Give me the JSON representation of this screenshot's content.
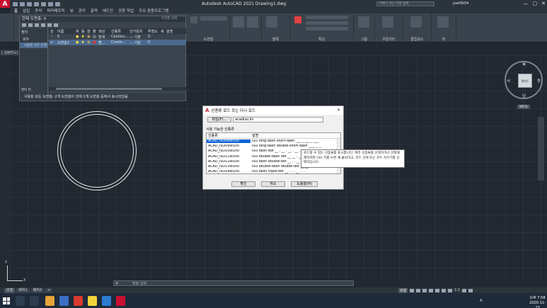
{
  "app": {
    "title": "Autodesk AutoCAD 2021   Drawing1.dwg",
    "logo_letter": "A",
    "search_placeholder": "키워드 또는 구문 입력",
    "user": "joe0604",
    "window_controls": [
      "—",
      "▢",
      "✕"
    ]
  },
  "menubar": [
    "홈",
    "삽입",
    "주석",
    "파라메트릭",
    "뷰",
    "관리",
    "출력",
    "애드인",
    "공동 작업",
    "주요 응용프로그램"
  ],
  "ribbon": {
    "groups": [
      "그리기",
      "수정",
      "도면층",
      "주석",
      "블록",
      "특성",
      "그룹",
      "유틸리티",
      "클립보드",
      "뷰"
    ],
    "layer_dropdown": "0",
    "bylayer": "ByLayer"
  },
  "file_tab": "[-][평면도]",
  "layer_panel": {
    "title": "현재 도면층: 0",
    "search": "도면층 검색",
    "filter_items": [
      "필터",
      "모두",
      "사용된 모든 도면층"
    ],
    "columns": [
      "상",
      "이름",
      "켜",
      "동",
      "잠",
      "플",
      "색상",
      "선종류",
      "선가중치",
      "투명도",
      "새",
      "설명"
    ],
    "rows": [
      {
        "name": "0",
        "color": "흰색",
        "linetype": "Continu...",
        "lineweight": "— 기본",
        "transparency": "0"
      },
      {
        "name": "도면층1",
        "color": "빨...",
        "linetype": "Contin...",
        "lineweight": "— 기본",
        "transparency": "0"
      }
    ],
    "invert_filter": "필터 반",
    "status": "사용된 모든 도면층: 2개 도면층이 전체 2개 도면층 중에서 표시되었음"
  },
  "viewcube": {
    "top": "평면도",
    "n": "북",
    "s": "남",
    "e": "동",
    "w": "서",
    "wcs": "WCS"
  },
  "dialog": {
    "title": "선종류 로드 또는 다시 로드",
    "file_button": "파일(F)...",
    "file_value": "acadiso.lin",
    "list_label": "사용 가능한 선종류",
    "col_linetype": "선종류",
    "col_desc": "설명",
    "rows": [
      {
        "name": "ACAD_ISO08W100",
        "desc": "ISO long-dash short-dash ___ _ ___ _ ___"
      },
      {
        "name": "ACAD_ISO09W100",
        "desc": "ISO long-dash double-short-dash ____ _ _"
      },
      {
        "name": "ACAD_ISO10W100",
        "desc": "ISO dash dot __ . __ . __ . __ . __"
      },
      {
        "name": "ACAD_ISO11W100",
        "desc": "ISO double-dash dot __ __ . __ __ ."
      },
      {
        "name": "ACAD_ISO12W100",
        "desc": "ISO dash double-dot __ . . __ . . __"
      },
      {
        "name": "ACAD_ISO13W100",
        "desc": "ISO double-dash double-dot __ __ . ."
      },
      {
        "name": "ACAD_ISO14W100",
        "desc": "ISO dash triple-dot __ . . . __ . . ."
      },
      {
        "name": "ACAD_ISO15W100",
        "desc": "ISO double-dash triple-dot __ __ . . ."
      }
    ],
    "ok": "확인",
    "cancel": "취소",
    "help": "도움말(H)"
  },
  "tooltip": "로드할 수 있는 선종류를 표시합니다. 여러 선종류를 선택하거나 선택해제하려면 Ctrl 키를 누른 채 클릭하고, 모두 선택 또는 모두 지우기를 선택하십시오.",
  "command": {
    "x": "✕",
    "placeholder": "명령 입력"
  },
  "layout_tabs": [
    "모형",
    "배치1",
    "배치2",
    "+"
  ],
  "status": {
    "model": "모형",
    "scale": "1:1"
  },
  "ucs": {
    "x": "X",
    "y": "Y"
  },
  "taskbar": {
    "time": "오후 7:58",
    "date": "2020-11-23",
    "lang": "A"
  }
}
